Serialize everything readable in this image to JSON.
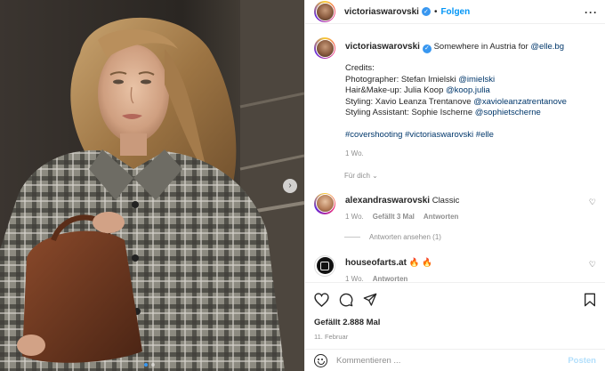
{
  "post": {
    "username": "victoriaswarovski",
    "follow_label": "Folgen",
    "more_icon": "more-horizontal-icon",
    "caption_location": "Somewhere in Austria for",
    "caption_mention": "@elle.bg",
    "credits_title": "Credits:",
    "credits": [
      {
        "label": "Photographer: Stefan Imielski",
        "handle": "@imielski"
      },
      {
        "label": "Hair&Make-up: Julia Koop",
        "handle": "@koop.julia"
      },
      {
        "label": "Styling: Xavio Leanza Trentanove",
        "handle": "@xavioleanzatrentanove"
      },
      {
        "label": "Styling Assistant: Sophie Ischerne",
        "handle": "@sophietscherne"
      }
    ],
    "hashtags": "#covershooting #victoriaswarovski #elle",
    "age": "1 Wo.",
    "translate_label": "Für dich",
    "likes": "Gefällt 2.888 Mal",
    "date": "11. Februar"
  },
  "comments": [
    {
      "username": "alexandraswarovski",
      "text": "Classic",
      "age": "1 Wo.",
      "likes": "Gefällt 3 Mal",
      "reply_label": "Antworten",
      "view_replies": "Antworten ansehen (1)"
    },
    {
      "username": "houseofarts.at",
      "text": "🔥 🔥",
      "age": "1 Wo.",
      "reply_label": "Antworten"
    }
  ],
  "comment_bar": {
    "placeholder": "Kommentieren ...",
    "post_label": "Posten"
  },
  "carousel": {
    "next_icon": "chevron-right-icon",
    "total": 2,
    "active_index": 0
  },
  "colors": {
    "accent": "#0095f6",
    "link": "#00376b",
    "muted": "#8e8e8e"
  }
}
